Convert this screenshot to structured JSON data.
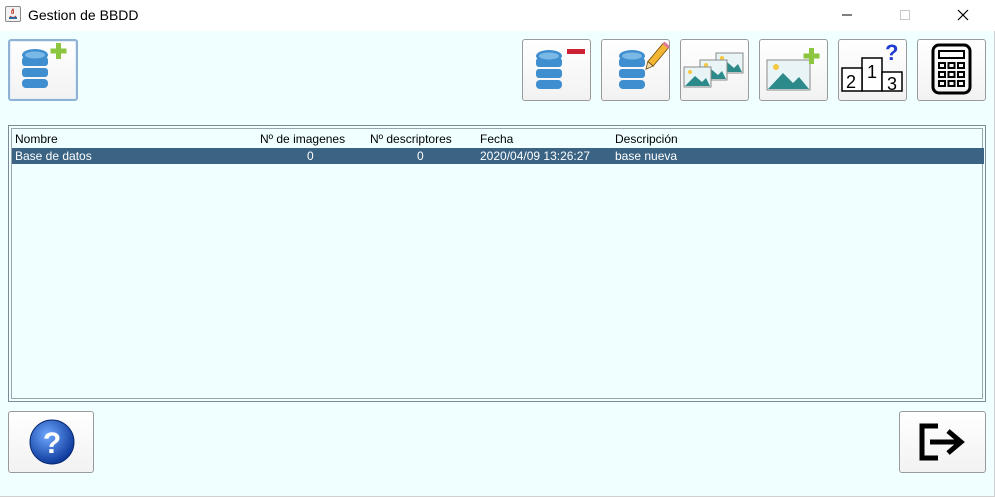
{
  "window": {
    "title": "Gestion de BBDD"
  },
  "toolbar": {
    "add_db_icon": "database-plus-icon",
    "remove_db_icon": "database-minus-icon",
    "edit_db_icon": "database-pencil-icon",
    "images_icon": "multiple-images-icon",
    "add_image_icon": "image-plus-icon",
    "ranking_icon": "podium-question-icon",
    "calculator_icon": "calculator-icon"
  },
  "table": {
    "columns": [
      "Nombre",
      "Nº de imagenes",
      "Nº descriptores",
      "Fecha",
      "Descripción"
    ],
    "rows": [
      {
        "name": "Base de datos",
        "images": "0",
        "descriptors": "0",
        "date": "2020/04/09 13:26:27",
        "description": "base nueva",
        "selected": true
      }
    ]
  },
  "footer": {
    "help_icon": "help-question-icon",
    "exit_icon": "exit-arrow-icon"
  },
  "colors": {
    "background": "#f0ffff",
    "selection": "#3b6383",
    "db_blue": "#3f8fd0",
    "plus_green": "#8cc63f",
    "minus_red": "#cc2233"
  }
}
